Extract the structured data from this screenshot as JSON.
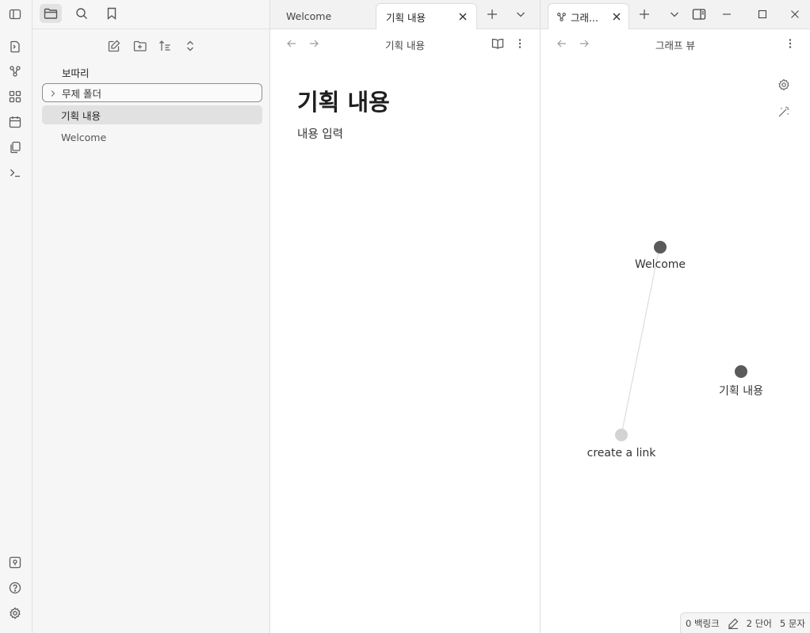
{
  "sidebar": {
    "vault_name": "보따리",
    "tree": [
      {
        "label": "무제 폴더",
        "type": "folder"
      },
      {
        "label": "기획 내용",
        "type": "file",
        "active": true
      },
      {
        "label": "Welcome",
        "type": "file"
      }
    ]
  },
  "editor": {
    "tabs": [
      {
        "label": "Welcome"
      },
      {
        "label": "기획 내용",
        "active": true
      }
    ],
    "view_title": "기획 내용",
    "doc_title": "기획 내용",
    "doc_body": "내용 입력"
  },
  "graph": {
    "tab_label": "그래...",
    "view_title": "그래프 뷰",
    "nodes": [
      {
        "label": "Welcome",
        "color": "#5a5a5a"
      },
      {
        "label": "기획 내용",
        "color": "#5a5a5a"
      },
      {
        "label": "create a link",
        "color": "#d3d3d3"
      }
    ]
  },
  "status": {
    "backlinks": "0 백링크",
    "words": "2 단어",
    "chars": "5 문자"
  }
}
